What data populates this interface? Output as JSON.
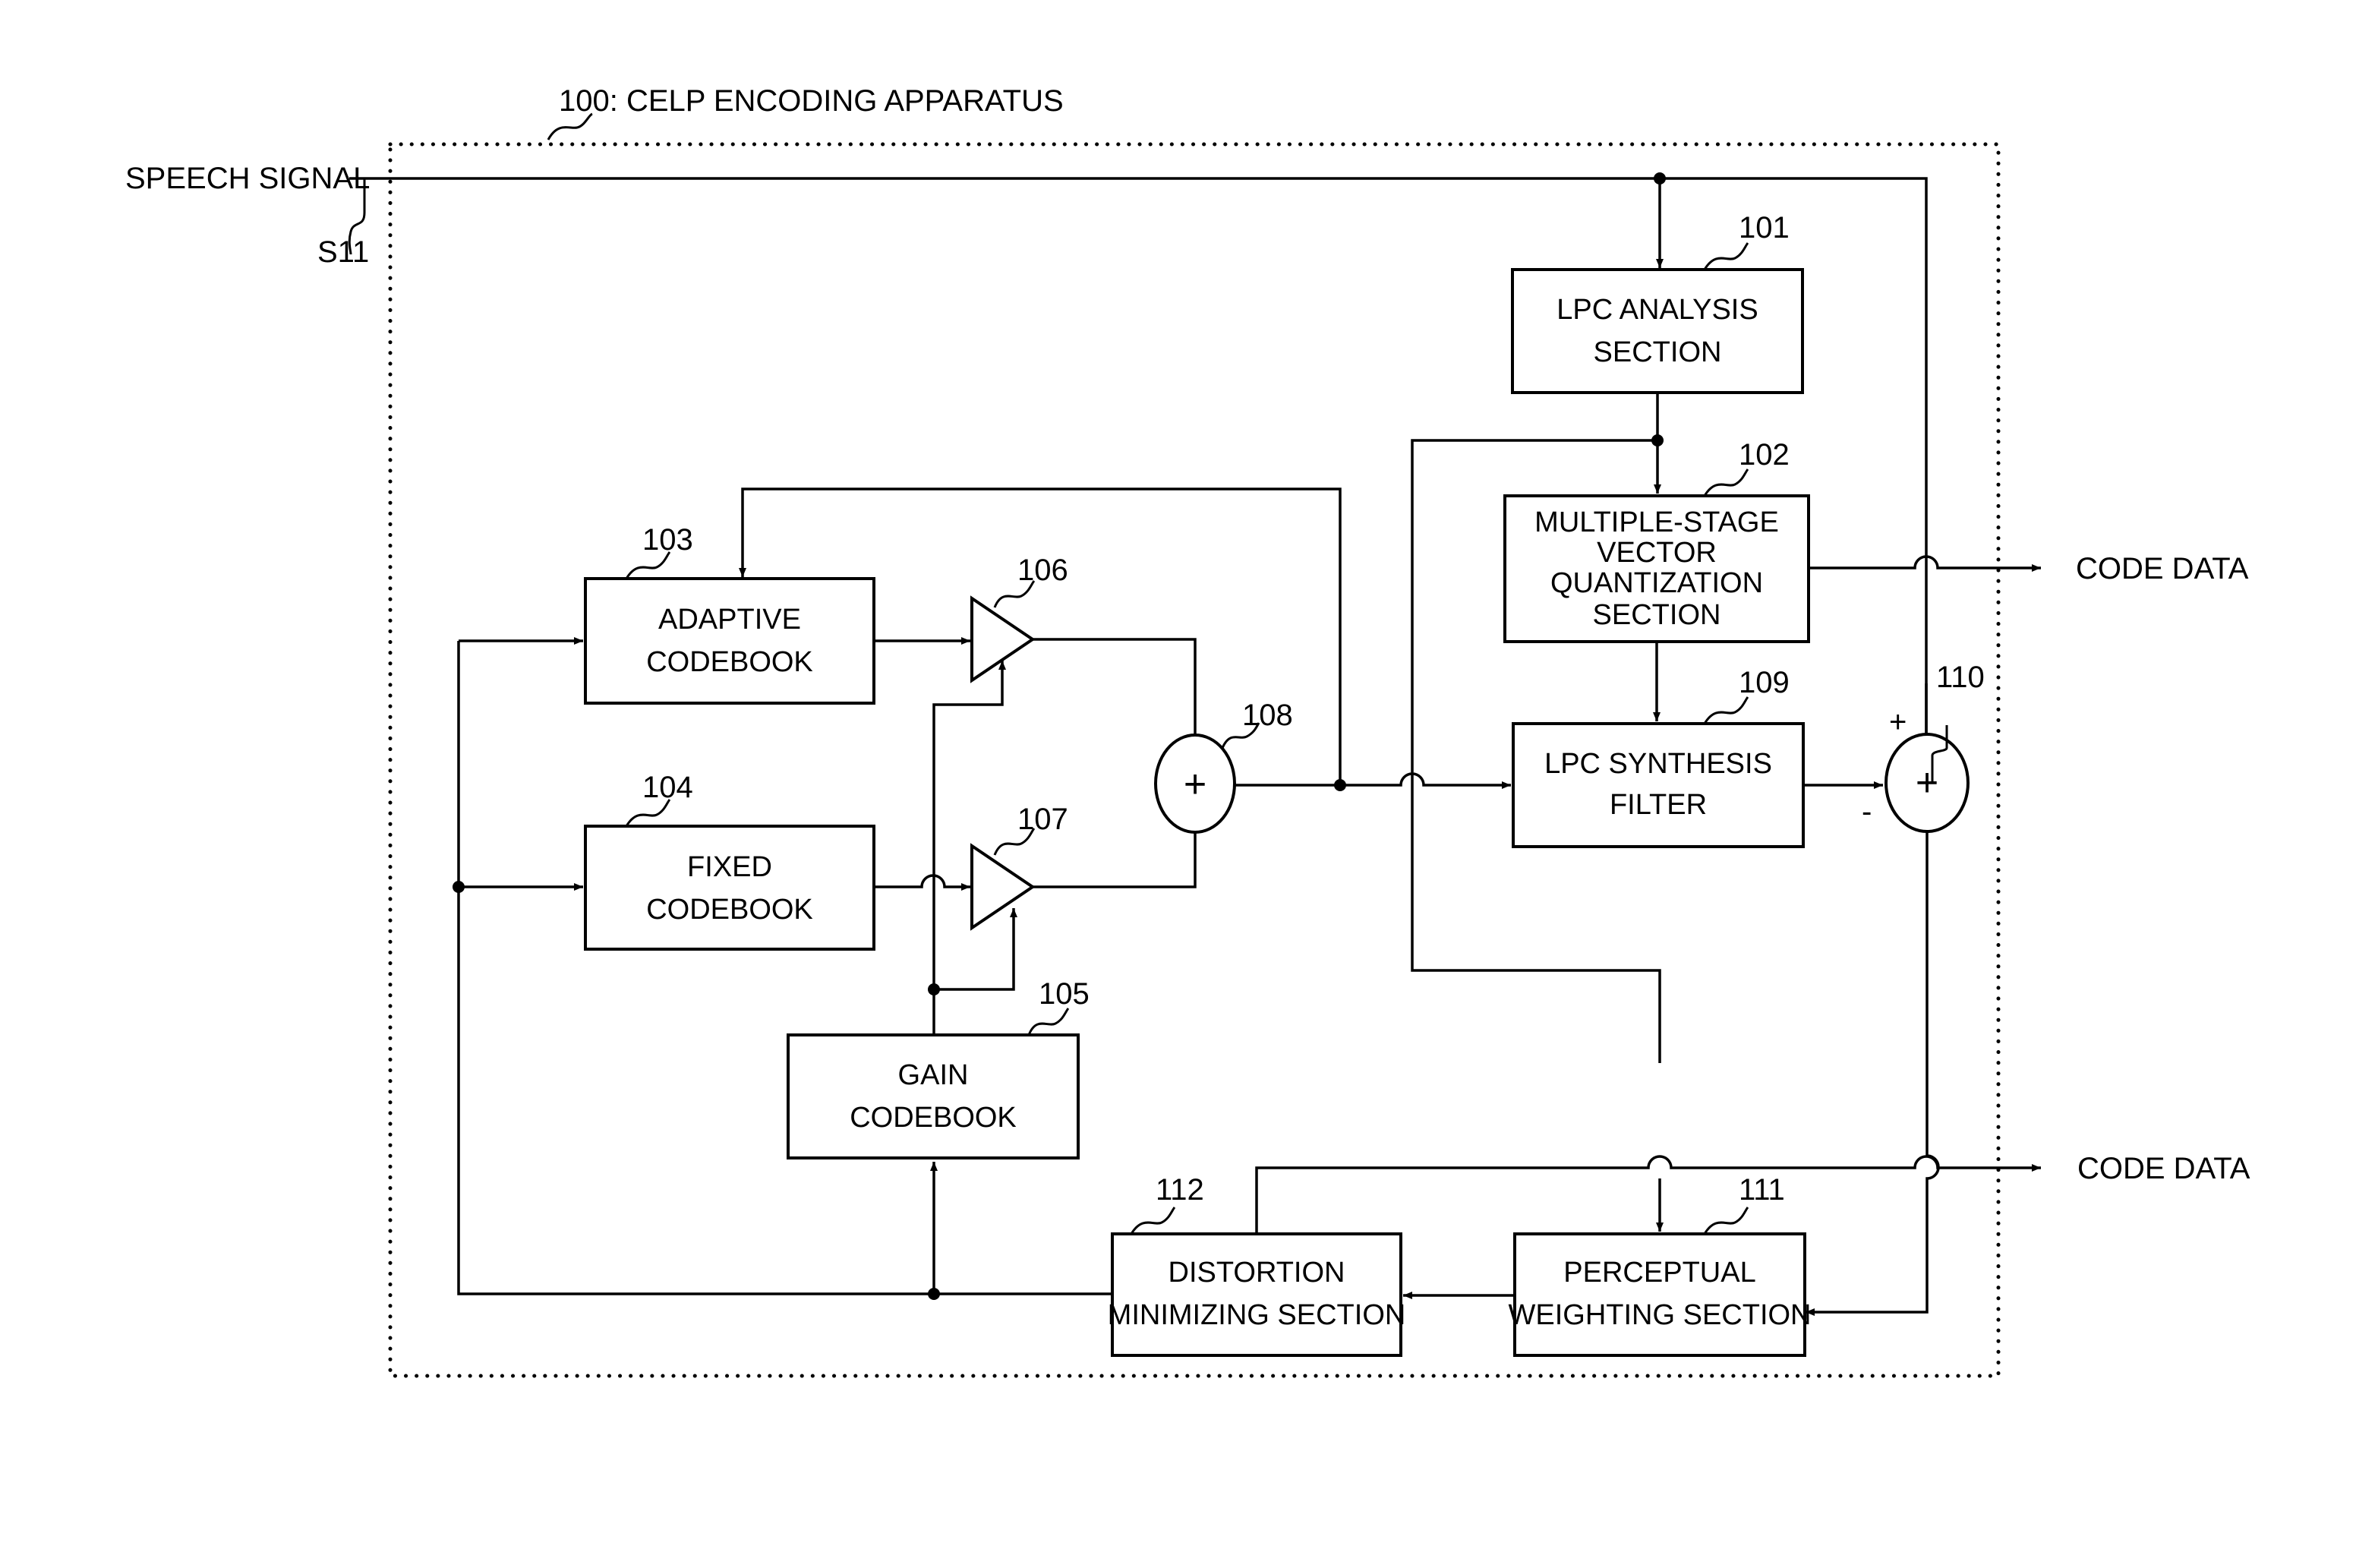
{
  "title": "100: CELP ENCODING APPARATUS",
  "input": {
    "label": "SPEECH SIGNAL",
    "ref": "S11"
  },
  "outputs": [
    {
      "label": "CODE DATA"
    },
    {
      "label": "CODE DATA"
    }
  ],
  "blocks": {
    "lpc_analysis": {
      "ref": "101",
      "lines": [
        "LPC ANALYSIS",
        "SECTION"
      ]
    },
    "msvq": {
      "ref": "102",
      "lines": [
        "MULTIPLE-STAGE",
        "VECTOR",
        "QUANTIZATION",
        "SECTION"
      ]
    },
    "adaptive_codebook": {
      "ref": "103",
      "lines": [
        "ADAPTIVE",
        "CODEBOOK"
      ]
    },
    "fixed_codebook": {
      "ref": "104",
      "lines": [
        "FIXED",
        "CODEBOOK"
      ]
    },
    "gain_codebook": {
      "ref": "105",
      "lines": [
        "GAIN",
        "CODEBOOK"
      ]
    },
    "lpc_synthesis": {
      "ref": "109",
      "lines": [
        "LPC SYNTHESIS",
        "FILTER"
      ]
    },
    "perceptual_weighting": {
      "ref": "111",
      "lines": [
        "PERCEPTUAL",
        "WEIGHTING SECTION"
      ]
    },
    "distortion_min": {
      "ref": "112",
      "lines": [
        "DISTORTION",
        "MINIMIZING SECTION"
      ]
    }
  },
  "amplifiers": {
    "amp1": {
      "ref": "106"
    },
    "amp2": {
      "ref": "107"
    }
  },
  "adders": {
    "adder108": {
      "ref": "108",
      "symbol": "+"
    },
    "adder110": {
      "ref": "110",
      "symbol": "+",
      "plus_sign": "+",
      "minus_sign": "-"
    }
  }
}
